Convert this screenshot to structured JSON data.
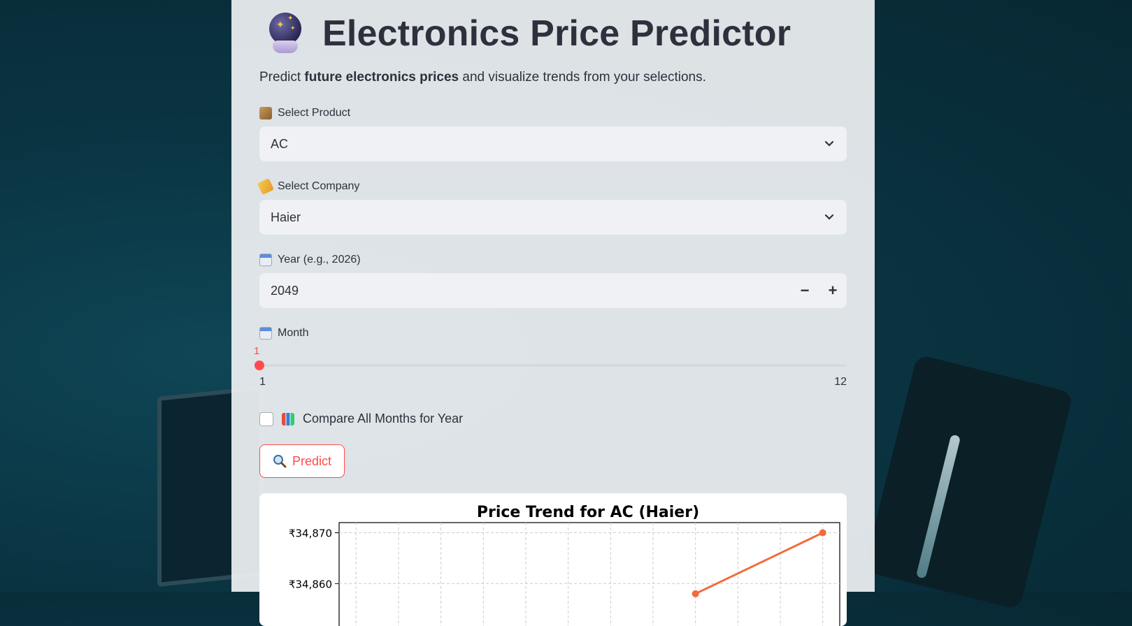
{
  "app": {
    "title": "Electronics Price Predictor",
    "title_icon": "crystal-ball-icon",
    "subtitle_prefix": "Predict ",
    "subtitle_bold": "future electronics prices",
    "subtitle_suffix": " and visualize trends from your selections."
  },
  "form": {
    "product": {
      "icon": "package-icon",
      "label": "Select Product",
      "value": "AC"
    },
    "company": {
      "icon": "tag-icon",
      "label": "Select Company",
      "value": "Haier"
    },
    "year": {
      "icon": "calendar-icon",
      "label": "Year (e.g., 2026)",
      "value": "2049",
      "decrement": "−",
      "increment": "+"
    },
    "month": {
      "icon": "calendar-icon",
      "label": "Month",
      "value": "1",
      "min": "1",
      "max": "12",
      "fraction": 0
    },
    "compare": {
      "icon": "bar-chart-icon",
      "label": "Compare All Months for Year",
      "checked": false
    },
    "predict_button": {
      "icon": "search-icon",
      "label": "Predict"
    }
  },
  "colors": {
    "accent": "#ff4b4b",
    "line": "#f26b3a",
    "text": "#2e313d"
  },
  "chart_data": {
    "type": "line",
    "title": "Price Trend for AC (Haier)",
    "ytick_labels": [
      "₹34,870",
      "₹34,860"
    ],
    "ytick_values": [
      34870,
      34860
    ],
    "series": [
      {
        "points": [
          {
            "x": 9,
            "y": 34858
          },
          {
            "x": 12,
            "y": 34870
          }
        ]
      }
    ],
    "x_range": [
      0.6,
      12.4
    ],
    "y_range": [
      34850,
      34872
    ],
    "grid": true
  }
}
